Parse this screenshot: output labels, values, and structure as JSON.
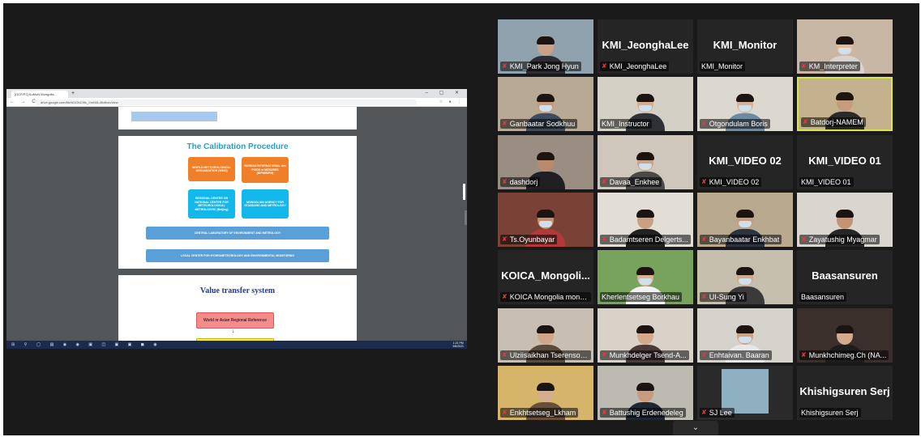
{
  "browser": {
    "tab_title": "[GCF/P2] KoMoN Mongolia...",
    "tab_close": "×",
    "new_tab": "+",
    "window_controls": "– ▢ ✕",
    "nav_icons": "← → C",
    "url": "drive.google.com/file/d/1ObC9fc_XmN4Ldfcrfkxn/view",
    "ext_icons": "☆ ● ⋮"
  },
  "slides": {
    "calibration": {
      "title": "The Calibration Procedure",
      "wmo": "WORLD METEOROLOGICAL ORGANIZATION (WMO)",
      "bipm": "BUREAU INTERNATIONAL des POIDS et MESURES (BIPM/BIPM)",
      "regional": "REGIONAL CENTER OR NATIONAL CENTER FOR METEOROLOGICAL METROLOGYIC (Beijing)",
      "mongolian": "MONGOLIAN AGENCY FOR STANDARD AND METROLOGY",
      "central": "CENTRAL LABORATORY OF ENVIRONMENT AND METROLOGY",
      "local": "LOCAL CENTER FOR HYDROMETEOROLOGY AND ENVIRONMENTAL MONITORING"
    },
    "value_transfer": {
      "title": "Value transfer system",
      "box1": "World or Asian Regional Reference",
      "arrow": "↓"
    }
  },
  "taskbar": {
    "icons": "⊞ ⚲ ◯ ▤ ◉ ◉ ▣ ◫ ▣ ▣ ◼ ◉",
    "time": "1:21 PM",
    "date": "9/6/2021"
  },
  "gallery_toggle": "⌄",
  "participants": [
    {
      "name": "KMI_Park Jong Hyun",
      "video": true,
      "muted": true,
      "bg": "#8fa2ad",
      "skin": "#c9a184",
      "shirt": "#2d2d33",
      "mask": false
    },
    {
      "name": "KMI_JeonghaLee",
      "video": false,
      "muted": true,
      "big": "KMI_JeonghaLee"
    },
    {
      "name": "KMI_Monitor",
      "video": false,
      "muted": false,
      "big": "KMI_Monitor"
    },
    {
      "name": "KM_Interpreter",
      "video": true,
      "muted": true,
      "bg": "#c9b7a6",
      "skin": "#e2b89a",
      "shirt": "#d9d3cf",
      "mask": true
    },
    {
      "name": "Ganbaatar Sodkhuu",
      "video": true,
      "muted": true,
      "bg": "#b7a993",
      "skin": "#c7987a",
      "shirt": "#3d4b5c",
      "mask": true
    },
    {
      "name": "KMI_Instructor",
      "video": true,
      "muted": false,
      "bg": "#d4d0c6",
      "skin": "#d6ad8f",
      "shirt": "#2f3137",
      "mask": true
    },
    {
      "name": "Otgondulam Boris",
      "video": true,
      "muted": true,
      "bg": "#dbd8d0",
      "skin": "#d9b195",
      "shirt": "#6e8aa0",
      "mask": true
    },
    {
      "name": "Batdorj-NAMEM",
      "video": true,
      "muted": true,
      "bg": "#c4b18d",
      "skin": "#c69c7c",
      "shirt": "#2a2a2a",
      "mask": false
    },
    {
      "name": "dashdorj",
      "video": true,
      "muted": true,
      "bg": "#9a8e83",
      "skin": "#b98b6c",
      "shirt": "#1f1f24",
      "mask": false
    },
    {
      "name": "Davaa_Enkhee",
      "video": true,
      "muted": true,
      "bg": "#cfc7bc",
      "skin": "#caa286",
      "shirt": "#4a4a4a",
      "mask": true
    },
    {
      "name": "KMI_VIDEO 02",
      "video": false,
      "muted": true,
      "big": "KMI_VIDEO 02"
    },
    {
      "name": "KMI_VIDEO 01",
      "video": false,
      "muted": false,
      "big": "KMI_VIDEO 01"
    },
    {
      "name": "Ts.Oyunbayar",
      "video": true,
      "muted": true,
      "bg": "#7a4136",
      "skin": "#c48f6f",
      "shirt": "#b33838",
      "mask": true
    },
    {
      "name": "Badamtseren Delgerts...",
      "video": true,
      "muted": true,
      "bg": "#e2ded5",
      "skin": "#c9a083",
      "shirt": "#222222",
      "mask": false
    },
    {
      "name": "Bayanbaatar Enkhbat",
      "video": true,
      "muted": true,
      "bg": "#b9a98f",
      "skin": "#c79c7e",
      "shirt": "#2e3340",
      "mask": true
    },
    {
      "name": "Zayatushig Myagmar",
      "video": true,
      "muted": true,
      "bg": "#d9d6cf",
      "skin": "#c39474",
      "shirt": "#262626",
      "mask": false
    },
    {
      "name": "KOICA Mongolia monit...",
      "video": false,
      "muted": true,
      "big": "KOICA_Mongoli..."
    },
    {
      "name": "Kherlentsetseg Borkhau",
      "video": true,
      "muted": false,
      "bg": "#78a35d",
      "skin": "#dab394",
      "shirt": "#f2f2f2",
      "mask": true
    },
    {
      "name": "UI-Sung Yi",
      "video": true,
      "muted": true,
      "bg": "#c7bfae",
      "skin": "#d1a98b",
      "shirt": "#3a3a3a",
      "mask": true
    },
    {
      "name": "Baasansuren",
      "video": false,
      "muted": false,
      "big": "Baasansuren"
    },
    {
      "name": "Ulziisaikhan Tserensod...",
      "video": true,
      "muted": true,
      "bg": "#c8bfb2",
      "skin": "#cfa688",
      "shirt": "#5a4a3a",
      "mask": false
    },
    {
      "name": "Munkhdelger Tsend-A...",
      "video": true,
      "muted": true,
      "bg": "#d8d2c8",
      "skin": "#d3aa8c",
      "shirt": "#4b3a38",
      "mask": false
    },
    {
      "name": "Enhtaivan. Baaran",
      "video": true,
      "muted": true,
      "bg": "#d5d2cb",
      "skin": "#cda285",
      "shirt": "#e7e7e7",
      "mask": true
    },
    {
      "name": "Munkhchimeg.Ch (NA...",
      "video": true,
      "muted": true,
      "bg": "#3a2f2a",
      "skin": "#d3aa8c",
      "shirt": "#1d1d1d",
      "mask": false
    },
    {
      "name": "Enkhtsetseg_Lkham",
      "video": true,
      "muted": true,
      "bg": "#d6b56a",
      "skin": "#d6ad8f",
      "shirt": "#6a4e3c",
      "mask": false
    },
    {
      "name": "Battushig Erdenedeleg",
      "video": true,
      "muted": true,
      "bg": "#bdbab2",
      "skin": "#c79c7e",
      "shirt": "#1f2733",
      "mask": false
    },
    {
      "name": "SJ Lee",
      "video": true,
      "muted": true,
      "bg": "#2a2a2a",
      "screen": "#8fb0c0"
    },
    {
      "name": "Khishigsuren Serj",
      "video": false,
      "muted": false,
      "big": "Khishigsuren Serj"
    }
  ]
}
